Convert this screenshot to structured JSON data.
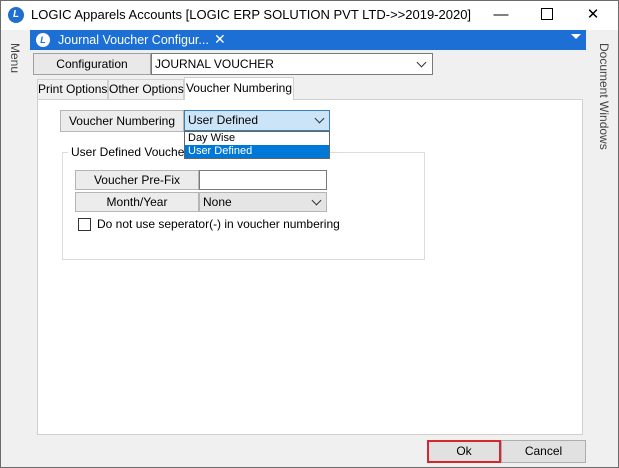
{
  "window": {
    "title": "LOGIC Apparels Accounts  [LOGIC ERP SOLUTION PVT LTD->>2019-2020]",
    "minimize": "—",
    "close": "✕"
  },
  "side_rails": {
    "left": "Menu",
    "right": "Document Windows"
  },
  "doc_tab": {
    "label": "Journal Voucher Configur...",
    "close": "✕"
  },
  "configuration": {
    "label": "Configuration",
    "value": "JOURNAL VOUCHER"
  },
  "tabs": [
    {
      "label": "Print Options"
    },
    {
      "label": "Other Options"
    },
    {
      "label": "Voucher Numbering",
      "active": true
    }
  ],
  "voucher_numbering": {
    "label": "Voucher Numbering",
    "selected": "User Defined",
    "options": [
      "Day Wise",
      "User Defined"
    ]
  },
  "user_defined": {
    "title": "User Defined Voucher N",
    "prefix_label": "Voucher Pre-Fix",
    "prefix_value": "",
    "month_year_label": "Month/Year",
    "month_year_value": "None",
    "separator_checkbox": "Do not use seperator(-) in voucher numbering",
    "separator_checked": false
  },
  "buttons": {
    "ok": "Ok",
    "cancel": "Cancel"
  },
  "colors": {
    "accent": "#1c6fd4",
    "highlight": "#0078d7",
    "ok_border": "#d9262c"
  }
}
